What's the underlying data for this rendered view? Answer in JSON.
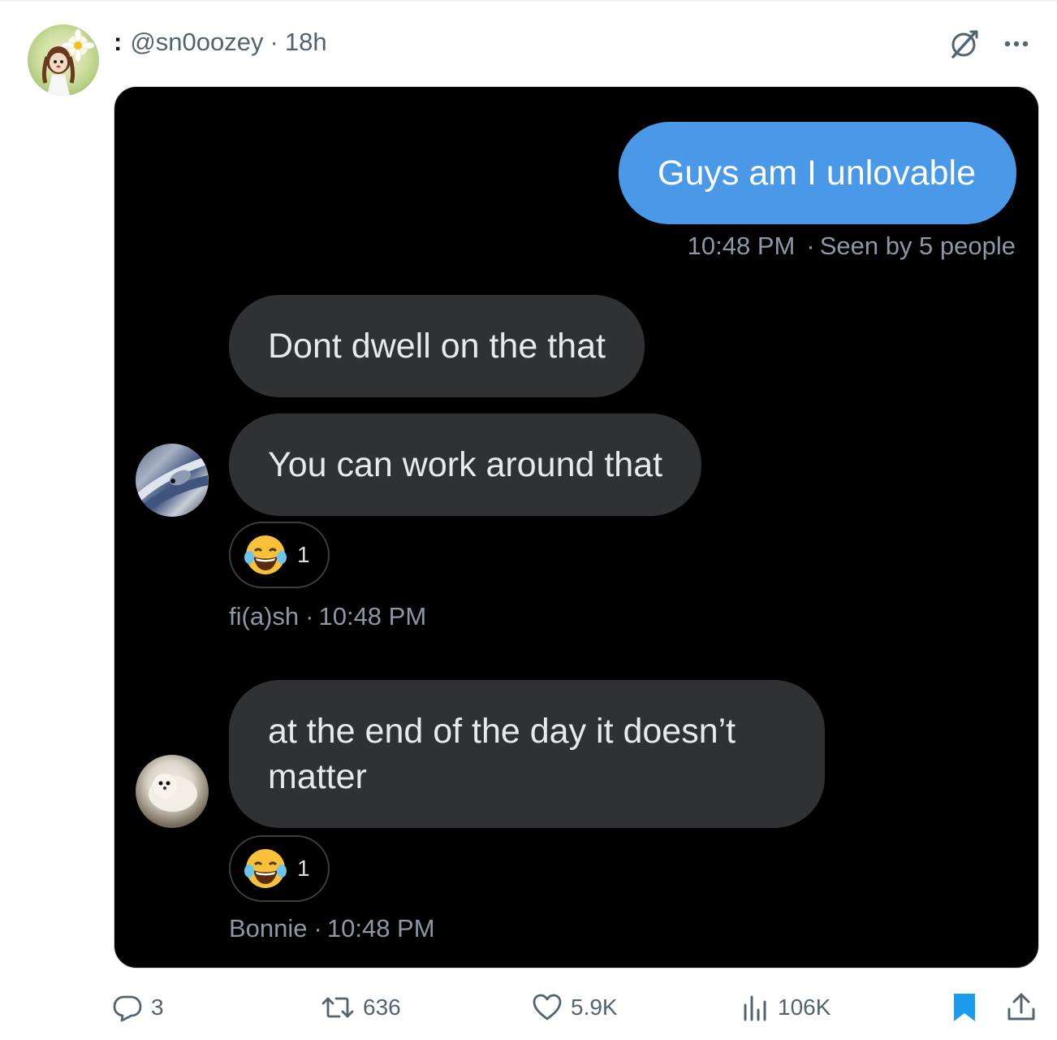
{
  "post": {
    "handle": "@sn0oozey",
    "separator": "·",
    "time": "18h",
    "name_prefix": ":"
  },
  "header_icons": [
    "grok-icon",
    "more-options-icon"
  ],
  "messages": [
    {
      "id": "m1",
      "from": "self",
      "text": "Guys am I unlovable",
      "time": "10:48 PM",
      "status": "Seen by 5 people"
    },
    {
      "id": "m2",
      "from": "fi(a)sh",
      "text": "Dont dwell on the that"
    },
    {
      "id": "m3",
      "from": "fi(a)sh",
      "text": "You can work around that",
      "reaction": {
        "emoji": "😂",
        "count": "1"
      },
      "sender": "fi(a)sh",
      "time": "10:48 PM"
    },
    {
      "id": "m4",
      "from": "Bonnie",
      "text": "at the end of the day it doesn’t matter",
      "reaction": {
        "emoji": "😂",
        "count": "1"
      },
      "sender": "Bonnie",
      "time": "10:48 PM"
    }
  ],
  "meta_separator": "·",
  "actions": {
    "replies": "3",
    "reposts": "636",
    "likes": "5.9K",
    "views": "106K"
  },
  "colors": {
    "sent_bubble": "#4a99e9",
    "received_bubble": "#2f3133",
    "media_background": "#000000",
    "bookmark_active": "#1d9bf0",
    "secondary_text": "#536471"
  }
}
